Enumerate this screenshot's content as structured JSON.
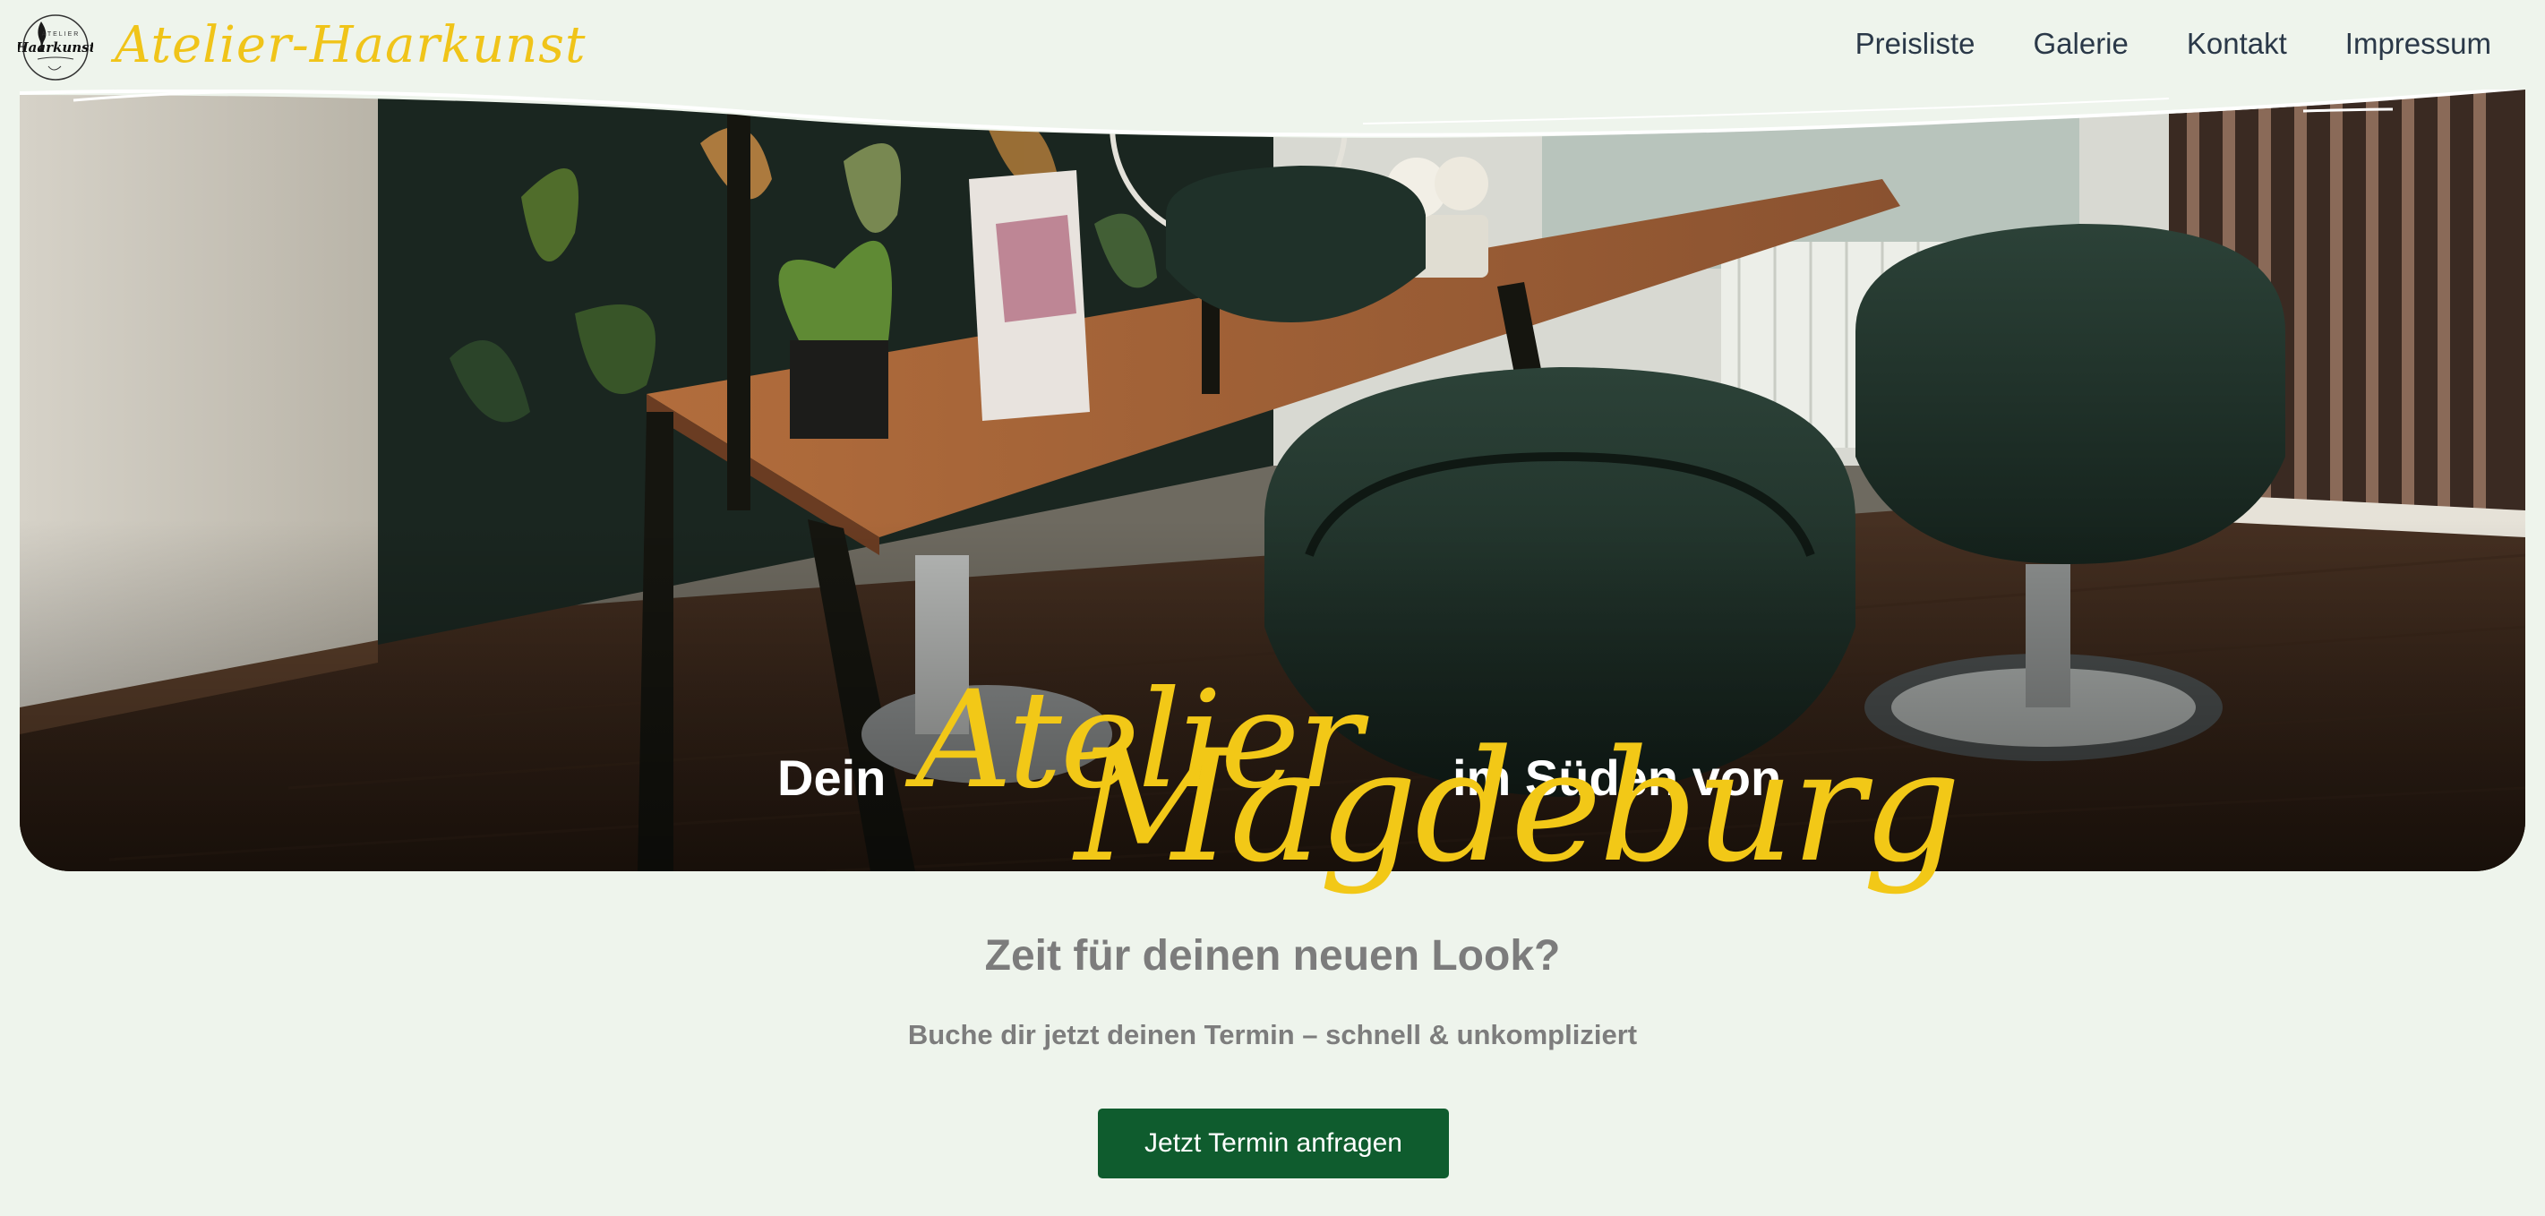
{
  "brand": {
    "name": "Atelier-Haarkunst",
    "logo_text_top": "ATELIER",
    "logo_text_main": "Haarkunst",
    "logo_icon": "woman-silhouette-icon"
  },
  "nav": {
    "items": [
      {
        "label": "Preisliste"
      },
      {
        "label": "Galerie"
      },
      {
        "label": "Kontakt"
      },
      {
        "label": "Impressum"
      }
    ]
  },
  "hero": {
    "line1_left": "Dein",
    "line1_script": "Atelier",
    "line1_right": "im Süden von",
    "line2_script": "Magdeburg"
  },
  "cta": {
    "title": "Zeit für deinen neuen Look?",
    "subtitle": "Buche dir jetzt deinen Termin – schnell & unkompliziert",
    "button_label": "Jetzt Termin anfragen"
  },
  "colors": {
    "background": "#eef4ec",
    "accent_gold": "#f2c817",
    "nav_text": "#2a3848",
    "cta_button": "#0f5c2e",
    "muted_text": "#7c7c7c"
  }
}
